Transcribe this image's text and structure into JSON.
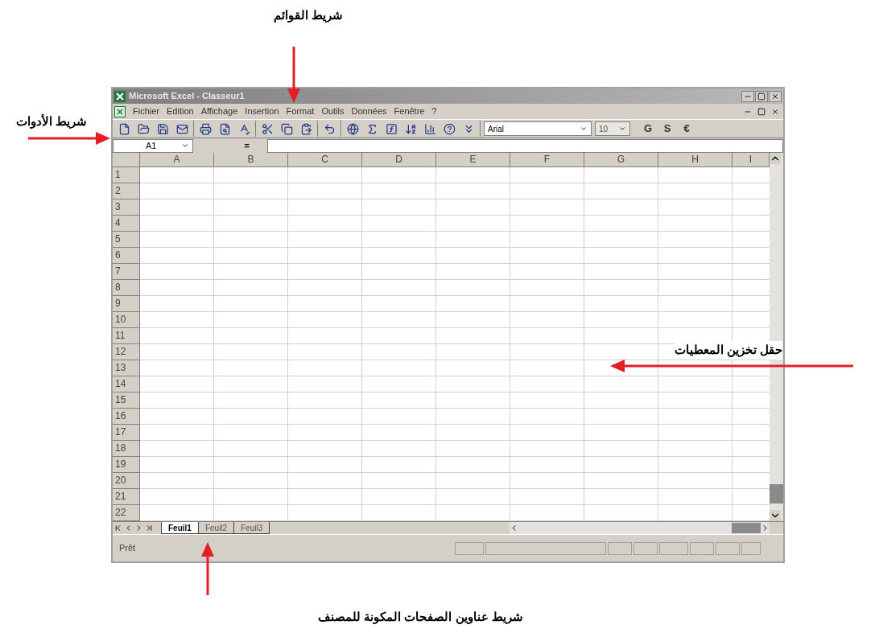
{
  "annotations": [
    {
      "kind": "menu",
      "text": "شريط القوائم"
    },
    {
      "kind": "toolbar",
      "text": "شريط الأدوات"
    },
    {
      "kind": "cells",
      "text": "حقل تخزين المعطيات"
    },
    {
      "kind": "tabs",
      "text": "شريط عناوين الصفحات المكونة للمصنف"
    }
  ],
  "window": {
    "title": "Microsoft Excel - Classeur1",
    "menu": [
      "Fichier",
      "Edition",
      "Affichage",
      "Insertion",
      "Format",
      "Outils",
      "Données",
      "Fenêtre",
      "?"
    ],
    "toolbar": {
      "font": "Arial",
      "size": "10",
      "format_buttons": [
        "G",
        "S",
        "€"
      ]
    },
    "formula_bar": {
      "name_box": "A1",
      "equals": "="
    },
    "columns": [
      "A",
      "B",
      "C",
      "D",
      "E",
      "F",
      "G",
      "H",
      "I"
    ],
    "rows": [
      "1",
      "2",
      "3",
      "4",
      "5",
      "6",
      "7",
      "8",
      "9",
      "10",
      "11",
      "12",
      "13",
      "14",
      "15",
      "16",
      "17",
      "18",
      "19",
      "20",
      "21",
      "22"
    ],
    "sheet_tabs": [
      {
        "label": "Feuil1",
        "selected": true
      },
      {
        "label": "Feuil2",
        "selected": false
      },
      {
        "label": "Feuil3",
        "selected": false
      }
    ],
    "status_bar": "Prêt"
  }
}
